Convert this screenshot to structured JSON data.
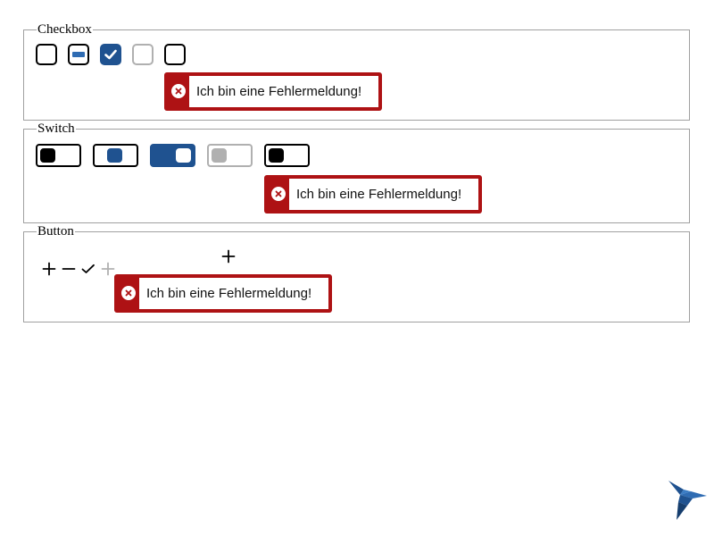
{
  "sections": {
    "checkbox": {
      "legend": "Checkbox"
    },
    "switch": {
      "legend": "Switch"
    },
    "button": {
      "legend": "Button"
    }
  },
  "error_message": "Ich bin eine Fehlermeldung!",
  "colors": {
    "primary": "#1f5290",
    "primary_light": "#2f6cb3",
    "error": "#ae1214",
    "disabled": "#b0b0b0",
    "border": "#a0a0a0"
  },
  "icons": {
    "add": "plus-icon",
    "remove": "minus-icon",
    "confirm": "checkmark-icon",
    "logo": "hummingbird-logo-icon"
  }
}
